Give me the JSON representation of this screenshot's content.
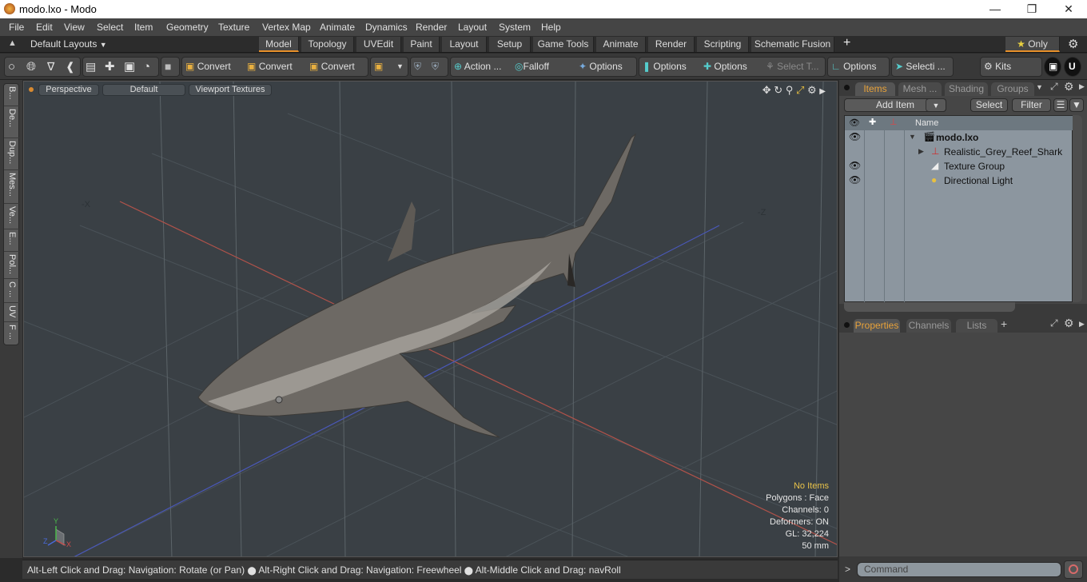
{
  "window": {
    "title": "modo.lxo - Modo",
    "controls": [
      "minimize",
      "maximize",
      "close"
    ]
  },
  "menubar": [
    "File",
    "Edit",
    "View",
    "Select",
    "Item",
    "Geometry",
    "Texture",
    "Vertex Map",
    "Animate",
    "Dynamics",
    "Render",
    "Layout",
    "System",
    "Help"
  ],
  "layoutbar": {
    "layouts_label": "Default Layouts",
    "tabs": [
      "Model",
      "Topology",
      "UVEdit",
      "Paint",
      "Layout",
      "Setup",
      "Game Tools",
      "Animate",
      "Render",
      "Scripting",
      "Schematic Fusion"
    ],
    "active_tab": "Model",
    "add_tab": "+",
    "only_label": "Only"
  },
  "toolbar": {
    "convert1": "Convert",
    "convert2": "Convert",
    "convert3": "Convert",
    "action": "Action",
    "action_more": "...",
    "falloff": "Falloff",
    "options1": "Options",
    "options2": "Options",
    "options3": "Options",
    "select_t": "Select T...",
    "options4": "Options",
    "selecti": "Selecti ...",
    "kits": "Kits"
  },
  "left_tabs": [
    "B...",
    "De...",
    "Dup...",
    "Mes...",
    "Ve...",
    "E...",
    "Pol...",
    "C ...",
    "UV",
    "F ..."
  ],
  "viewport": {
    "view_mode": "Perspective",
    "shading": "Default",
    "textures": "Viewport Textures",
    "axis_neg_x": "-X",
    "axis_neg_z": "-Z",
    "info": {
      "selection": "No Items",
      "polygons": "Polygons : Face",
      "channels": "Channels: 0",
      "deformers": "Deformers: ON",
      "gl": "GL: 32,224",
      "lens": "50 mm"
    },
    "gizmo": {
      "x": "X",
      "y": "Y",
      "z": "Z"
    }
  },
  "status": {
    "hint1": "Alt-Left Click and Drag: Navigation: Rotate (or Pan)",
    "hint2": "Alt-Right Click and Drag: Navigation: Freewheel",
    "hint3": "Alt-Middle Click and Drag: navRoll"
  },
  "items_panel": {
    "tabs": [
      "Items",
      "Mesh ...",
      "Shading",
      "Groups"
    ],
    "active_tab": "Items",
    "add_item": "Add Item",
    "select": "Select",
    "filter": "Filter",
    "column_name": "Name",
    "items": [
      {
        "name": "modo.lxo",
        "type": "scene",
        "visible": true,
        "bold": true
      },
      {
        "name": "Realistic_Grey_Reef_Shark",
        "type": "locator",
        "visible": false,
        "bold": false
      },
      {
        "name": "Texture Group",
        "type": "texture-group",
        "visible": true,
        "bold": false
      },
      {
        "name": "Directional Light",
        "type": "light",
        "visible": true,
        "bold": false
      }
    ]
  },
  "properties_panel": {
    "tabs": [
      "Properties",
      "Channels",
      "Lists"
    ],
    "active_tab": "Properties",
    "add_tab": "+"
  },
  "command": {
    "prompt": ">",
    "placeholder": "Command"
  },
  "colors": {
    "accent": "#e8902a",
    "active_tab_text": "#e8a23a",
    "info_highlight": "#e8c24a",
    "axis_x": "#c0504a",
    "axis_z": "#4a5ac0"
  }
}
